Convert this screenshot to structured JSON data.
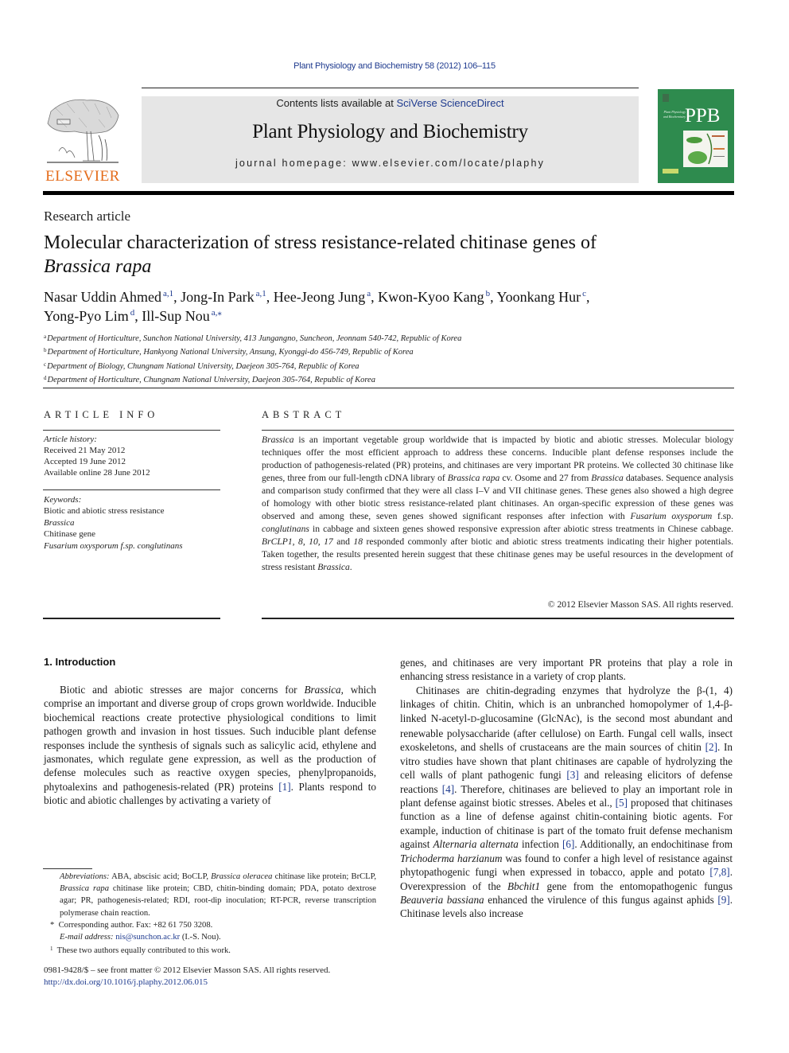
{
  "running_head": "Plant Physiology and Biochemistry 58 (2012) 106–115",
  "header": {
    "publisher_logo_text": "ELSEVIER",
    "contents_prefix": "Contents lists available at ",
    "contents_link": "SciVerse ScienceDirect",
    "journal_name": "Plant Physiology and Biochemistry",
    "homepage": "journal homepage: www.elsevier.com/locate/plaphy",
    "cover_abbrev": "PPB",
    "cover_small_title": "Plant Physiology and Biochemistry"
  },
  "colors": {
    "link": "#1f3b8f",
    "elsevier_orange": "#e46c1b",
    "cover_green": "#2e8b4e",
    "banner_gray": "#e6e6e6"
  },
  "article": {
    "type": "Research article",
    "title_main": "Molecular characterization of stress resistance-related chitinase genes of",
    "title_species": "Brassica rapa",
    "authors": [
      {
        "name": "Nasar Uddin Ahmed",
        "sup": "a,1",
        "sep": ", "
      },
      {
        "name": "Jong-In Park",
        "sup": "a,1",
        "sep": ", "
      },
      {
        "name": "Hee-Jeong Jung",
        "sup": "a",
        "sep": ", "
      },
      {
        "name": "Kwon-Kyoo Kang",
        "sup": "b",
        "sep": ", "
      },
      {
        "name": "Yoonkang Hur",
        "sup": "c",
        "sep": ","
      },
      {
        "name": "Yong-Pyo Lim",
        "sup": "d",
        "sep": ", "
      },
      {
        "name": "Ill-Sup Nou",
        "sup": "a,⁎",
        "sep": ""
      }
    ],
    "affiliations": [
      {
        "key": "a",
        "text": "Department of Horticulture, Sunchon National University, 413 Jungangno, Suncheon, Jeonnam 540-742, Republic of Korea"
      },
      {
        "key": "b",
        "text": "Department of Horticulture, Hankyong National University, Ansung, Kyonggi-do 456-749, Republic of Korea"
      },
      {
        "key": "c",
        "text": "Department of Biology, Chungnam National University, Daejeon 305-764, Republic of Korea"
      },
      {
        "key": "d",
        "text": "Department of Horticulture, Chungnam National University, Daejeon 305-764, Republic of Korea"
      }
    ]
  },
  "article_info": {
    "heading": "ARTICLE INFO",
    "history_label": "Article history:",
    "received": "Received 21 May 2012",
    "accepted": "Accepted 19 June 2012",
    "online": "Available online 28 June 2012",
    "keywords_label": "Keywords:",
    "keywords": [
      {
        "text": "Biotic and abiotic stress resistance",
        "italic": false
      },
      {
        "text": "Brassica",
        "italic": true
      },
      {
        "text": "Chitinase gene",
        "italic": false
      },
      {
        "text": "Fusarium oxysporum f.sp. conglutinans",
        "italic": true
      }
    ]
  },
  "abstract": {
    "heading": "ABSTRACT",
    "parts": [
      {
        "t": "Brassica",
        "i": true
      },
      {
        "t": " is an important vegetable group worldwide that is impacted by biotic and abiotic stresses. Molecular biology techniques offer the most efficient approach to address these concerns. Inducible plant defense responses include the production of pathogenesis-related (PR) proteins, and chitinases are very important PR proteins. We collected 30 chitinase like genes, three from our full-length cDNA library of ",
        "i": false
      },
      {
        "t": "Brassica rapa",
        "i": true
      },
      {
        "t": " cv. Osome and 27 from ",
        "i": false
      },
      {
        "t": "Brassica",
        "i": true
      },
      {
        "t": " databases. Sequence analysis and comparison study confirmed that they were all class I–V and VII chitinase genes. These genes also showed a high degree of homology with other biotic stress resistance-related plant chitinases. An organ-specific expression of these genes was observed and among these, seven genes showed significant responses after infection with ",
        "i": false
      },
      {
        "t": "Fusarium oxysporum",
        "i": true
      },
      {
        "t": " f.sp. ",
        "i": false
      },
      {
        "t": "conglutinans",
        "i": true
      },
      {
        "t": " in cabbage and sixteen genes showed responsive expression after abiotic stress treatments in Chinese cabbage. ",
        "i": false
      },
      {
        "t": "BrCLP1, 8, 10, 17",
        "i": true
      },
      {
        "t": " and ",
        "i": false
      },
      {
        "t": "18",
        "i": true
      },
      {
        "t": " responded commonly after biotic and abiotic stress treatments indicating their higher potentials. Taken together, the results presented herein suggest that these chitinase genes may be useful resources in the development of stress resistant ",
        "i": false
      },
      {
        "t": "Brassica",
        "i": true
      },
      {
        "t": ".",
        "i": false
      }
    ],
    "copyright": "© 2012 Elsevier Masson SAS. All rights reserved."
  },
  "introduction": {
    "heading": "1.  Introduction",
    "left_para": [
      {
        "t": "Biotic and abiotic stresses are major concerns for ",
        "k": "n"
      },
      {
        "t": "Brassica",
        "k": "i"
      },
      {
        "t": ", which comprise an important and diverse group of crops grown worldwide. Inducible biochemical reactions create protective physiological conditions to limit pathogen growth and invasion in host tissues. Such inducible plant defense responses include the synthesis of signals such as salicylic acid, ethylene and jasmonates, which regulate gene expression, as well as the production of defense molecules such as reactive oxygen species, phenylpropanoids, phytoalexins and pathogenesis-related (PR) proteins ",
        "k": "n"
      },
      {
        "t": "[1]",
        "k": "l"
      },
      {
        "t": ". Plants respond to biotic and abiotic challenges by activating a variety of",
        "k": "n"
      }
    ],
    "right_para1": [
      {
        "t": "genes, and chitinases are very important PR proteins that play a role in enhancing stress resistance in a variety of crop plants.",
        "k": "n"
      }
    ],
    "right_para2": [
      {
        "t": "Chitinases are chitin-degrading enzymes that hydrolyze the β-(1, 4) linkages of chitin. Chitin, which is an unbranched homopolymer of 1,4-β-linked N-acetyl-",
        "k": "n"
      },
      {
        "t": "D",
        "k": "sc"
      },
      {
        "t": "-glucosamine (GlcNAc), is the second most abundant and renewable polysaccharide (after cellulose) on Earth. Fungal cell walls, insect exoskeletons, and shells of crustaceans are the main sources of chitin ",
        "k": "n"
      },
      {
        "t": "[2]",
        "k": "l"
      },
      {
        "t": ". In vitro studies have shown that plant chitinases are capable of hydrolyzing the cell walls of plant pathogenic fungi ",
        "k": "n"
      },
      {
        "t": "[3]",
        "k": "l"
      },
      {
        "t": " and releasing elicitors of defense reactions ",
        "k": "n"
      },
      {
        "t": "[4]",
        "k": "l"
      },
      {
        "t": ". Therefore, chitinases are believed to play an important role in plant defense against biotic stresses. Abeles et al., ",
        "k": "n"
      },
      {
        "t": "[5]",
        "k": "l"
      },
      {
        "t": " proposed that chitinases function as a line of defense against chitin-containing biotic agents. For example, induction of chitinase is part of the tomato fruit defense mechanism against ",
        "k": "n"
      },
      {
        "t": "Alternaria alternata",
        "k": "i"
      },
      {
        "t": " infection ",
        "k": "n"
      },
      {
        "t": "[6]",
        "k": "l"
      },
      {
        "t": ". Additionally, an endochitinase from ",
        "k": "n"
      },
      {
        "t": "Trichoderma harzianum",
        "k": "i"
      },
      {
        "t": " was found to confer a high level of resistance against phytopathogenic fungi when expressed in tobacco, apple and potato ",
        "k": "n"
      },
      {
        "t": "[7,8]",
        "k": "l"
      },
      {
        "t": ". Overexpression of the ",
        "k": "n"
      },
      {
        "t": "Bbchit1",
        "k": "i"
      },
      {
        "t": " gene from the entomopathogenic fungus ",
        "k": "n"
      },
      {
        "t": "Beauveria bassiana",
        "k": "i"
      },
      {
        "t": " enhanced the virulence of this fungus against aphids ",
        "k": "n"
      },
      {
        "t": "[9]",
        "k": "l"
      },
      {
        "t": ". Chitinase levels also increase",
        "k": "n"
      }
    ]
  },
  "footnotes": {
    "abbrev_label": "Abbreviations:",
    "abbrev_parts": [
      {
        "t": " ABA, abscisic acid; BoCLP, ",
        "k": "n"
      },
      {
        "t": "Brassica oleracea",
        "k": "i"
      },
      {
        "t": " chitinase like protein; BrCLP, ",
        "k": "n"
      },
      {
        "t": "Brassica rapa",
        "k": "i"
      },
      {
        "t": " chitinase like protein; CBD, chitin-binding domain; PDA, potato dextrose agar; PR, pathogenesis-related; RDI, root-dip inoculation; RT-PCR, reverse transcription polymerase chain reaction.",
        "k": "n"
      }
    ],
    "corresponding_mark": "*",
    "corresponding": "Corresponding author. Fax: +82 61 750 3208.",
    "email_label": "E-mail address:",
    "email": "nis@sunchon.ac.kr",
    "email_suffix": " (I.-S. Nou).",
    "equal_mark": "1",
    "equal": "These two authors equally contributed to this work."
  },
  "front_matter": {
    "issn_line": "0981-9428/$ – see front matter © 2012 Elsevier Masson SAS. All rights reserved.",
    "doi": "http://dx.doi.org/10.1016/j.plaphy.2012.06.015"
  }
}
